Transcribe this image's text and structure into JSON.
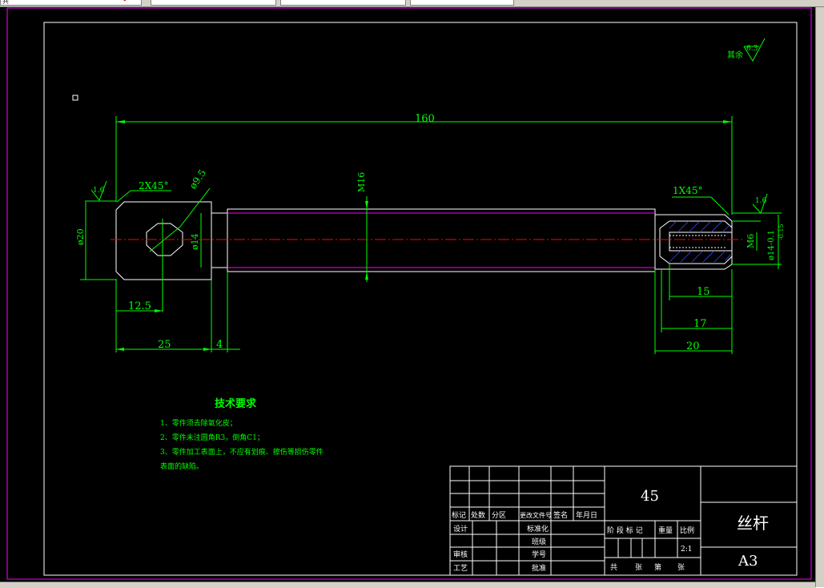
{
  "toolbar": {
    "fragment_text": "共",
    "search_glyph": "↷"
  },
  "drawing": {
    "roughness_rest_label": "其余",
    "roughness_rest_value": "6.3",
    "overall_length": "160",
    "chamfer_left": "2X45°",
    "hex_dim": "ø9.5",
    "thread_dim": "M16",
    "left_roughness": "1.6",
    "chamfer_right": "1X45°",
    "right_roughness": "1.6",
    "dia_20": "ø20",
    "dia_14": "ø14",
    "inner_thread": "M6",
    "dia_14_tol": "ø14-0.1",
    "dia_14_tol2": "-0.15",
    "dim_12_5": "12.5",
    "dim_25": "25",
    "dim_4": "4",
    "dim_15": "15",
    "dim_17": "17",
    "dim_20": "20"
  },
  "tech_requirements": {
    "title": "技术要求",
    "lines": [
      "1、零件须去除氧化皮；",
      "2、零件未注圆角R3，倒角C1；",
      "3、零件加工表面上，不应有划痕、擦伤等损伤零件",
      "表面的缺陷。"
    ]
  },
  "title_block": {
    "material": "45",
    "part_name": "丝杆",
    "sheet_size": "A3",
    "scale": "2:1",
    "headers": [
      "标记",
      "处数",
      "分区",
      "更改文件号",
      "签名",
      "年月日"
    ],
    "row_design": "设计",
    "row_review": "审核",
    "row_process": "工艺",
    "std": "标准化",
    "class_label": "班级",
    "student_id": "学号",
    "approve": "批准",
    "stage_mark": "阶 段 标 记",
    "weight": "重量",
    "ratio": "比例",
    "total_sheets": "共",
    "sheet": "张",
    "page_no": "第",
    "sheet2": "张"
  }
}
